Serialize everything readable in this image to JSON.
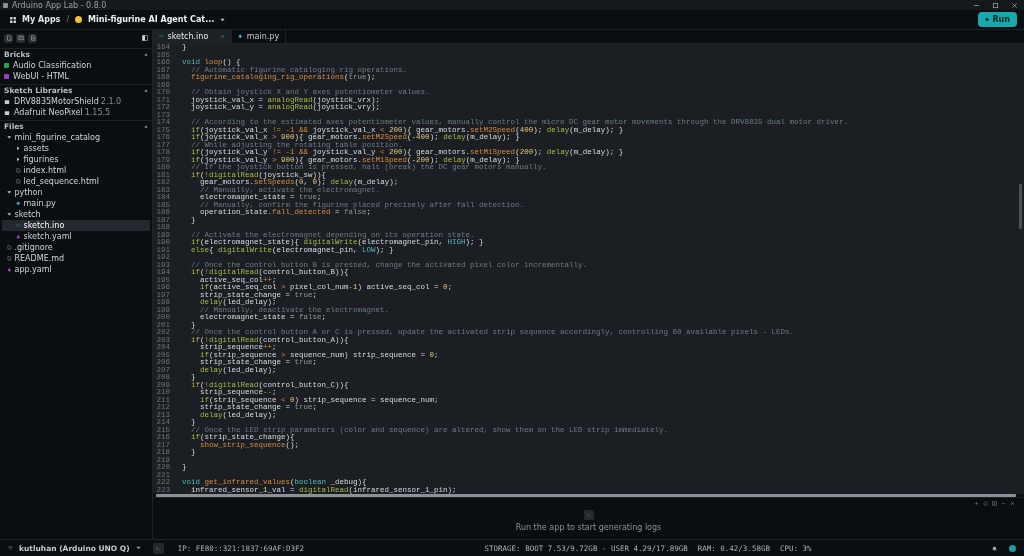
{
  "window": {
    "title": "Arduino App Lab - 0.8.0"
  },
  "header": {
    "home": "My Apps",
    "separator": "/",
    "app_title": "Mini-figurine AI Agent Cat...",
    "run": "Run"
  },
  "sidebar": {
    "bricks": {
      "title": "Bricks",
      "items": [
        {
          "name": "Audio Classification",
          "color": "#2e9e4f"
        },
        {
          "name": "WebUI - HTML",
          "color": "#8e44c9"
        }
      ]
    },
    "libraries": {
      "title": "Sketch Libraries",
      "items": [
        {
          "name": "DRV8835MotorShield",
          "version": "2.1.0"
        },
        {
          "name": "Adafruit NeoPixel",
          "version": "1.15.5"
        }
      ]
    },
    "files": {
      "title": "Files",
      "items": [
        {
          "name": "mini_figurine_catalog",
          "kind": "folder",
          "expanded": true,
          "selected": false,
          "children": [
            {
              "name": "assets",
              "kind": "folder",
              "expanded": false,
              "selected": false
            },
            {
              "name": "figurines",
              "kind": "folder",
              "expanded": false,
              "selected": false
            },
            {
              "name": "index.html",
              "kind": "file",
              "selected": false
            },
            {
              "name": "led_sequence.html",
              "kind": "file",
              "selected": false
            }
          ]
        },
        {
          "name": "python",
          "kind": "folder",
          "expanded": true,
          "selected": false,
          "children": [
            {
              "name": "main.py",
              "kind": "python",
              "selected": false
            }
          ]
        },
        {
          "name": "sketch",
          "kind": "folder",
          "expanded": true,
          "selected": false,
          "children": [
            {
              "name": "sketch.ino",
              "kind": "sketch",
              "selected": true
            },
            {
              "name": "sketch.yaml",
              "kind": "yaml",
              "selected": false
            }
          ]
        },
        {
          "name": ".gitignore",
          "kind": "file",
          "selected": false
        },
        {
          "name": "README.md",
          "kind": "file",
          "selected": false
        },
        {
          "name": "app.yaml",
          "kind": "yaml",
          "selected": false
        }
      ]
    }
  },
  "editor": {
    "tabs": [
      {
        "label": "sketch.ino",
        "kind": "sketch",
        "selected": true
      },
      {
        "label": "main.py",
        "kind": "python",
        "selected": false
      }
    ],
    "lines": [
      {
        "number": "164",
        "tokens": [
          {
            "kind": "t",
            "text": "}"
          }
        ]
      },
      {
        "number": "165"
      },
      {
        "number": "166",
        "tokens": [
          {
            "kind": "k",
            "text": "void "
          },
          {
            "kind": "u",
            "text": "loop"
          },
          {
            "kind": "t",
            "text": "() {"
          }
        ]
      },
      {
        "number": "167",
        "tokens": [
          {
            "kind": "c",
            "text": "  // Automatic figurine cataloging rig operations."
          }
        ]
      },
      {
        "number": "168",
        "tokens": [
          {
            "kind": "u",
            "text": "  figurine_cataloging_rig_operations"
          },
          {
            "kind": "t",
            "text": "("
          },
          {
            "kind": "b",
            "text": "true"
          },
          {
            "kind": "t",
            "text": ");"
          }
        ]
      },
      {
        "number": "169"
      },
      {
        "number": "170",
        "tokens": [
          {
            "kind": "c",
            "text": "  // Obtain joystick X and Y axes potentiometer values."
          }
        ]
      },
      {
        "number": "171",
        "tokens": [
          {
            "kind": "t",
            "text": "  joystick_val_x = "
          },
          {
            "kind": "f",
            "text": "analogRead"
          },
          {
            "kind": "t",
            "text": "(joystick_vrx);"
          }
        ]
      },
      {
        "number": "172",
        "tokens": [
          {
            "kind": "t",
            "text": "  joystick_val_y = "
          },
          {
            "kind": "f",
            "text": "analogRead"
          },
          {
            "kind": "t",
            "text": "(joystick_vry);"
          }
        ]
      },
      {
        "number": "173"
      },
      {
        "number": "174",
        "tokens": [
          {
            "kind": "c",
            "text": "  // According to the estimated axes potentiometer values, manually control the micro DC gear motor movements through the DRV8835 dual motor driver."
          }
        ]
      },
      {
        "number": "175",
        "tokens": [
          {
            "kind": "f",
            "text": "  if"
          },
          {
            "kind": "t",
            "text": "(joystick_val_x "
          },
          {
            "kind": "o",
            "text": "!= -1 &&"
          },
          {
            "kind": "t",
            "text": " joystick_val_x "
          },
          {
            "kind": "o",
            "text": "<"
          },
          {
            "kind": "n",
            "text": " 200"
          },
          {
            "kind": "t",
            "text": "){ gear_motors."
          },
          {
            "kind": "u",
            "text": "setM2Speed"
          },
          {
            "kind": "t",
            "text": "("
          },
          {
            "kind": "n",
            "text": "400"
          },
          {
            "kind": "t",
            "text": "); "
          },
          {
            "kind": "f",
            "text": "delay"
          },
          {
            "kind": "t",
            "text": "(m_delay); }"
          }
        ]
      },
      {
        "number": "176",
        "tokens": [
          {
            "kind": "f",
            "text": "  if"
          },
          {
            "kind": "t",
            "text": "(joystick_val_x "
          },
          {
            "kind": "o",
            "text": ">"
          },
          {
            "kind": "n",
            "text": " 900"
          },
          {
            "kind": "t",
            "text": "){ gear_motors."
          },
          {
            "kind": "u",
            "text": "setM2Speed"
          },
          {
            "kind": "t",
            "text": "("
          },
          {
            "kind": "n",
            "text": "-400"
          },
          {
            "kind": "t",
            "text": "); "
          },
          {
            "kind": "f",
            "text": "delay"
          },
          {
            "kind": "t",
            "text": "(m_delay); }"
          }
        ]
      },
      {
        "number": "177",
        "tokens": [
          {
            "kind": "c",
            "text": "  // While adjusting the rotating table position."
          }
        ]
      },
      {
        "number": "178",
        "tokens": [
          {
            "kind": "f",
            "text": "  if"
          },
          {
            "kind": "t",
            "text": "(joystick_val_y "
          },
          {
            "kind": "o",
            "text": "!= -1 &&"
          },
          {
            "kind": "t",
            "text": " joystick_val_y "
          },
          {
            "kind": "o",
            "text": "<"
          },
          {
            "kind": "n",
            "text": " 200"
          },
          {
            "kind": "t",
            "text": "){ gear_motors."
          },
          {
            "kind": "u",
            "text": "setM1Speed"
          },
          {
            "kind": "t",
            "text": "("
          },
          {
            "kind": "n",
            "text": "200"
          },
          {
            "kind": "t",
            "text": "); "
          },
          {
            "kind": "f",
            "text": "delay"
          },
          {
            "kind": "t",
            "text": "(m_delay); }"
          }
        ]
      },
      {
        "number": "179",
        "tokens": [
          {
            "kind": "f",
            "text": "  if"
          },
          {
            "kind": "t",
            "text": "(joystick_val_y "
          },
          {
            "kind": "o",
            "text": ">"
          },
          {
            "kind": "n",
            "text": " 900"
          },
          {
            "kind": "t",
            "text": "){ gear_motors."
          },
          {
            "kind": "u",
            "text": "setM1Speed"
          },
          {
            "kind": "t",
            "text": "("
          },
          {
            "kind": "n",
            "text": "-200"
          },
          {
            "kind": "t",
            "text": "); "
          },
          {
            "kind": "f",
            "text": "delay"
          },
          {
            "kind": "t",
            "text": "(m_delay); }"
          }
        ]
      },
      {
        "number": "180",
        "tokens": [
          {
            "kind": "c",
            "text": "  // If the joystick button is pressed, halt (break) the DC gear motors manually."
          }
        ]
      },
      {
        "number": "181",
        "tokens": [
          {
            "kind": "f",
            "text": "  if"
          },
          {
            "kind": "t",
            "text": "("
          },
          {
            "kind": "o",
            "text": "!"
          },
          {
            "kind": "f",
            "text": "digitalRead"
          },
          {
            "kind": "t",
            "text": "(joystick_sw)){"
          }
        ]
      },
      {
        "number": "182",
        "tokens": [
          {
            "kind": "t",
            "text": "    gear_motors."
          },
          {
            "kind": "u",
            "text": "setSpeeds"
          },
          {
            "kind": "t",
            "text": "("
          },
          {
            "kind": "n",
            "text": "0"
          },
          {
            "kind": "t",
            "text": ", "
          },
          {
            "kind": "n",
            "text": "0"
          },
          {
            "kind": "t",
            "text": "); "
          },
          {
            "kind": "f",
            "text": "delay"
          },
          {
            "kind": "t",
            "text": "(m_delay);"
          }
        ]
      },
      {
        "number": "183",
        "tokens": [
          {
            "kind": "c",
            "text": "    // Manually, activate the electromagnet."
          }
        ]
      },
      {
        "number": "184",
        "tokens": [
          {
            "kind": "t",
            "text": "    electromagnet_state = "
          },
          {
            "kind": "b",
            "text": "true"
          },
          {
            "kind": "t",
            "text": ";"
          }
        ]
      },
      {
        "number": "185",
        "tokens": [
          {
            "kind": "c",
            "text": "    // Manually, confirm the figurine placed precisely after fall detection."
          }
        ]
      },
      {
        "number": "186",
        "tokens": [
          {
            "kind": "t",
            "text": "    operation_state."
          },
          {
            "kind": "u",
            "text": "fall_detected"
          },
          {
            "kind": "t",
            "text": " = "
          },
          {
            "kind": "b",
            "text": "false"
          },
          {
            "kind": "t",
            "text": ";"
          }
        ]
      },
      {
        "number": "187",
        "tokens": [
          {
            "kind": "t",
            "text": "  }"
          }
        ]
      },
      {
        "number": "188"
      },
      {
        "number": "189",
        "tokens": [
          {
            "kind": "c",
            "text": "  // Activate the electromagnet depending on its operation state."
          }
        ]
      },
      {
        "number": "190",
        "tokens": [
          {
            "kind": "f",
            "text": "  if"
          },
          {
            "kind": "t",
            "text": "(electromagnet_state){ "
          },
          {
            "kind": "f",
            "text": "digitalWrite"
          },
          {
            "kind": "t",
            "text": "(electromagnet_pin, "
          },
          {
            "kind": "k",
            "text": "HIGH"
          },
          {
            "kind": "t",
            "text": "); }"
          }
        ]
      },
      {
        "number": "191",
        "tokens": [
          {
            "kind": "f",
            "text": "  else"
          },
          {
            "kind": "t",
            "text": "{ "
          },
          {
            "kind": "f",
            "text": "digitalWrite"
          },
          {
            "kind": "t",
            "text": "(electromagnet_pin, "
          },
          {
            "kind": "k",
            "text": "LOW"
          },
          {
            "kind": "t",
            "text": "); }"
          }
        ]
      },
      {
        "number": "192"
      },
      {
        "number": "193",
        "tokens": [
          {
            "kind": "c",
            "text": "  // Once the control button B is pressed, change the activated pixel color incrementally."
          }
        ]
      },
      {
        "number": "194",
        "tokens": [
          {
            "kind": "f",
            "text": "  if"
          },
          {
            "kind": "t",
            "text": "("
          },
          {
            "kind": "o",
            "text": "!"
          },
          {
            "kind": "f",
            "text": "digitalRead"
          },
          {
            "kind": "t",
            "text": "(control_button_B)){"
          }
        ]
      },
      {
        "number": "195",
        "tokens": [
          {
            "kind": "t",
            "text": "    active_seq_col"
          },
          {
            "kind": "o",
            "text": "++"
          },
          {
            "kind": "t",
            "text": ";"
          }
        ]
      },
      {
        "number": "196",
        "tokens": [
          {
            "kind": "f",
            "text": "    if"
          },
          {
            "kind": "t",
            "text": "(active_seq_col "
          },
          {
            "kind": "o",
            "text": ">"
          },
          {
            "kind": "t",
            "text": " pixel_col_num"
          },
          {
            "kind": "o",
            "text": "-"
          },
          {
            "kind": "n",
            "text": "1"
          },
          {
            "kind": "t",
            "text": ") active_seq_col = "
          },
          {
            "kind": "n",
            "text": "0"
          },
          {
            "kind": "t",
            "text": ";"
          }
        ]
      },
      {
        "number": "197",
        "tokens": [
          {
            "kind": "t",
            "text": "    strip_state_change = "
          },
          {
            "kind": "b",
            "text": "true"
          },
          {
            "kind": "t",
            "text": ";"
          }
        ]
      },
      {
        "number": "198",
        "tokens": [
          {
            "kind": "f",
            "text": "    delay"
          },
          {
            "kind": "t",
            "text": "(led_delay);"
          }
        ]
      },
      {
        "number": "199",
        "tokens": [
          {
            "kind": "c",
            "text": "    // Manually, deactivate the electromagnet."
          }
        ]
      },
      {
        "number": "200",
        "tokens": [
          {
            "kind": "t",
            "text": "    electromagnet_state = "
          },
          {
            "kind": "b",
            "text": "false"
          },
          {
            "kind": "t",
            "text": ";"
          }
        ]
      },
      {
        "number": "201",
        "tokens": [
          {
            "kind": "t",
            "text": "  }"
          }
        ]
      },
      {
        "number": "202",
        "tokens": [
          {
            "kind": "c",
            "text": "  // Once the control button A or C is pressed, update the activated strip sequence accordingly, controlling 60 available pixels - LEDs."
          }
        ]
      },
      {
        "number": "203",
        "tokens": [
          {
            "kind": "f",
            "text": "  if"
          },
          {
            "kind": "t",
            "text": "("
          },
          {
            "kind": "o",
            "text": "!"
          },
          {
            "kind": "f",
            "text": "digitalRead"
          },
          {
            "kind": "t",
            "text": "(control_button_A)){"
          }
        ]
      },
      {
        "number": "204",
        "tokens": [
          {
            "kind": "t",
            "text": "    strip_sequence"
          },
          {
            "kind": "o",
            "text": "++"
          },
          {
            "kind": "t",
            "text": ";"
          }
        ]
      },
      {
        "number": "205",
        "tokens": [
          {
            "kind": "f",
            "text": "    if"
          },
          {
            "kind": "t",
            "text": "(strip_sequence "
          },
          {
            "kind": "o",
            "text": ">"
          },
          {
            "kind": "t",
            "text": " sequence_num) strip_sequence = "
          },
          {
            "kind": "n",
            "text": "0"
          },
          {
            "kind": "t",
            "text": ";"
          }
        ]
      },
      {
        "number": "206",
        "tokens": [
          {
            "kind": "t",
            "text": "    strip_state_change = "
          },
          {
            "kind": "b",
            "text": "true"
          },
          {
            "kind": "t",
            "text": ";"
          }
        ]
      },
      {
        "number": "207",
        "tokens": [
          {
            "kind": "f",
            "text": "    delay"
          },
          {
            "kind": "t",
            "text": "(led_delay);"
          }
        ]
      },
      {
        "number": "208",
        "tokens": [
          {
            "kind": "t",
            "text": "  }"
          }
        ]
      },
      {
        "number": "209",
        "tokens": [
          {
            "kind": "f",
            "text": "  if"
          },
          {
            "kind": "t",
            "text": "("
          },
          {
            "kind": "o",
            "text": "!"
          },
          {
            "kind": "f",
            "text": "digitalRead"
          },
          {
            "kind": "t",
            "text": "(control_button_C)){"
          }
        ]
      },
      {
        "number": "210",
        "tokens": [
          {
            "kind": "t",
            "text": "    strip_sequence"
          },
          {
            "kind": "o",
            "text": "--"
          },
          {
            "kind": "t",
            "text": ";"
          }
        ]
      },
      {
        "number": "211",
        "tokens": [
          {
            "kind": "f",
            "text": "    if"
          },
          {
            "kind": "t",
            "text": "(strip_sequence "
          },
          {
            "kind": "o",
            "text": "<"
          },
          {
            "kind": "n",
            "text": " 0"
          },
          {
            "kind": "t",
            "text": ") strip_sequence = sequence_num;"
          }
        ]
      },
      {
        "number": "212",
        "tokens": [
          {
            "kind": "t",
            "text": "    strip_state_change = "
          },
          {
            "kind": "b",
            "text": "true"
          },
          {
            "kind": "t",
            "text": ";"
          }
        ]
      },
      {
        "number": "213",
        "tokens": [
          {
            "kind": "f",
            "text": "    delay"
          },
          {
            "kind": "t",
            "text": "(led_delay);"
          }
        ]
      },
      {
        "number": "214",
        "tokens": [
          {
            "kind": "t",
            "text": "  }"
          }
        ]
      },
      {
        "number": "215",
        "tokens": [
          {
            "kind": "c",
            "text": "  // Once the LED strip parameters (color and sequence) are altered, show them on the LED strip immediately."
          }
        ]
      },
      {
        "number": "216",
        "tokens": [
          {
            "kind": "f",
            "text": "  if"
          },
          {
            "kind": "t",
            "text": "(strip_state_change){"
          }
        ]
      },
      {
        "number": "217",
        "tokens": [
          {
            "kind": "u",
            "text": "    show_strip_sequence"
          },
          {
            "kind": "t",
            "text": "();"
          }
        ]
      },
      {
        "number": "218",
        "tokens": [
          {
            "kind": "t",
            "text": "  }"
          }
        ]
      },
      {
        "number": "219"
      },
      {
        "number": "220",
        "tokens": [
          {
            "kind": "t",
            "text": "}"
          }
        ]
      },
      {
        "number": "221"
      },
      {
        "number": "222",
        "tokens": [
          {
            "kind": "k",
            "text": "void "
          },
          {
            "kind": "u",
            "text": "get_infrared_values"
          },
          {
            "kind": "t",
            "text": "("
          },
          {
            "kind": "k",
            "text": "boolean"
          },
          {
            "kind": "t",
            "text": " _debug){"
          }
        ]
      },
      {
        "number": "223",
        "tokens": [
          {
            "kind": "t",
            "text": "  infrared_sensor_1_val = "
          },
          {
            "kind": "f",
            "text": "digitalRead"
          },
          {
            "kind": "t",
            "text": "(infrared_sensor_1_pin);"
          }
        ]
      }
    ]
  },
  "console": {
    "empty_message": "Run the app to start generating logs"
  },
  "status_bar": {
    "device": "kutluhan (Arduino UNO Q)",
    "ip": "IP: FE80::321:1837:69AF:D3F2",
    "storage": "STORAGE: BOOT 7.53/9.72GB - USER 4.29/17.89GB",
    "ram": "RAM: 0.42/3.58GB",
    "cpu": "CPU: 3%"
  }
}
